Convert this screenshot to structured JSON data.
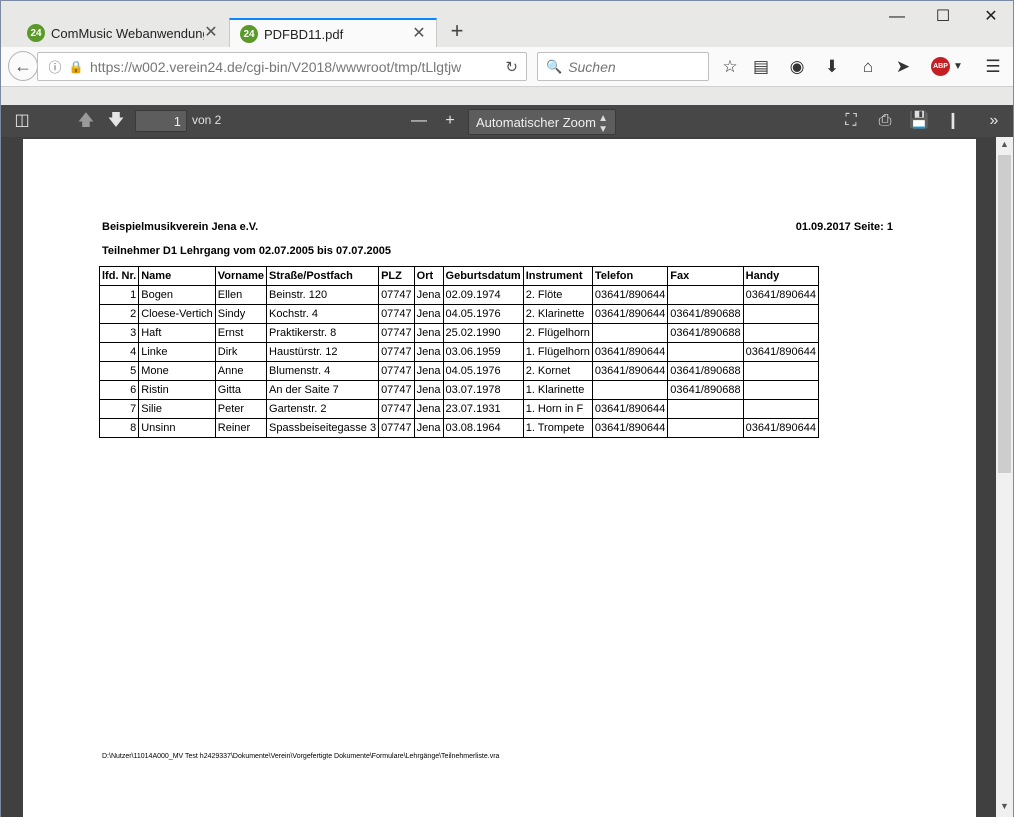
{
  "browser": {
    "tabs": [
      {
        "favicon": "24",
        "label": "ComMusic Webanwendung"
      },
      {
        "favicon": "24",
        "label": "PDFBD11.pdf"
      }
    ],
    "url": "https://w002.verein24.de/cgi-bin/V2018/wwwroot/tmp/tLlgtjw",
    "search_placeholder": "Suchen",
    "icons": [
      "back-arrow-icon",
      "info-icon",
      "lock-icon",
      "reload-icon",
      "search-icon",
      "bookmark-star-icon",
      "reading-list-icon",
      "pocket-icon",
      "download-icon",
      "home-icon",
      "send-icon",
      "adblock-icon",
      "menu-icon"
    ],
    "adblock_label": "ABP"
  },
  "pdf_toolbar": {
    "current_page": "1",
    "page_count_text": "von 2",
    "zoom": "Automatischer Zoom"
  },
  "document": {
    "organization": "Beispielmusikverein Jena e.V.",
    "date_page": "01.09.2017  Seite: 1",
    "subtitle": "Teilnehmer D1 Lehrgang vom 02.07.2005 bis 07.07.2005",
    "columns": [
      "lfd. Nr.",
      "Name",
      "Vorname",
      "Straße/Postfach",
      "PLZ",
      "Ort",
      "Geburtsdatum",
      "Instrument",
      "Telefon",
      "Fax",
      "Handy"
    ],
    "rows": [
      [
        "1",
        "Bogen",
        "Ellen",
        "Beinstr. 120",
        "07747",
        "Jena",
        "02.09.1974",
        "2. Flöte",
        "03641/890644",
        "",
        "03641/890644"
      ],
      [
        "2",
        "Cloese-Vertich",
        "Sindy",
        "Kochstr. 4",
        "07747",
        "Jena",
        "04.05.1976",
        "2. Klarinette",
        "03641/890644",
        "03641/890688",
        ""
      ],
      [
        "3",
        "Haft",
        "Ernst",
        "Praktikerstr. 8",
        "07747",
        "Jena",
        "25.02.1990",
        "2. Flügelhorn",
        "",
        "03641/890688",
        ""
      ],
      [
        "4",
        "Linke",
        "Dirk",
        "Haustürstr. 12",
        "07747",
        "Jena",
        "03.06.1959",
        "1. Flügelhorn",
        "03641/890644",
        "",
        "03641/890644"
      ],
      [
        "5",
        "Mone",
        "Anne",
        "Blumenstr. 4",
        "07747",
        "Jena",
        "04.05.1976",
        "2. Kornet",
        "03641/890644",
        "03641/890688",
        ""
      ],
      [
        "6",
        "Ristin",
        "Gitta",
        "An der Saite 7",
        "07747",
        "Jena",
        "03.07.1978",
        "1. Klarinette",
        "",
        "03641/890688",
        ""
      ],
      [
        "7",
        "Silie",
        "Peter",
        "Gartenstr. 2",
        "07747",
        "Jena",
        "23.07.1931",
        "1. Horn in F",
        "03641/890644",
        "",
        ""
      ],
      [
        "8",
        "Unsinn",
        "Reiner",
        "Spassbeiseitegasse 3",
        "07747",
        "Jena",
        "03.08.1964",
        "1. Trompete",
        "03641/890644",
        "",
        "03641/890644"
      ]
    ],
    "footer_path": "D:\\Nutzer\\11014A000_MV Test h2429337\\Dokumente\\Verein\\Vorgefertigte Dokumente\\Formulare\\Lehrgänge\\Teilnehmerliste.vra"
  }
}
